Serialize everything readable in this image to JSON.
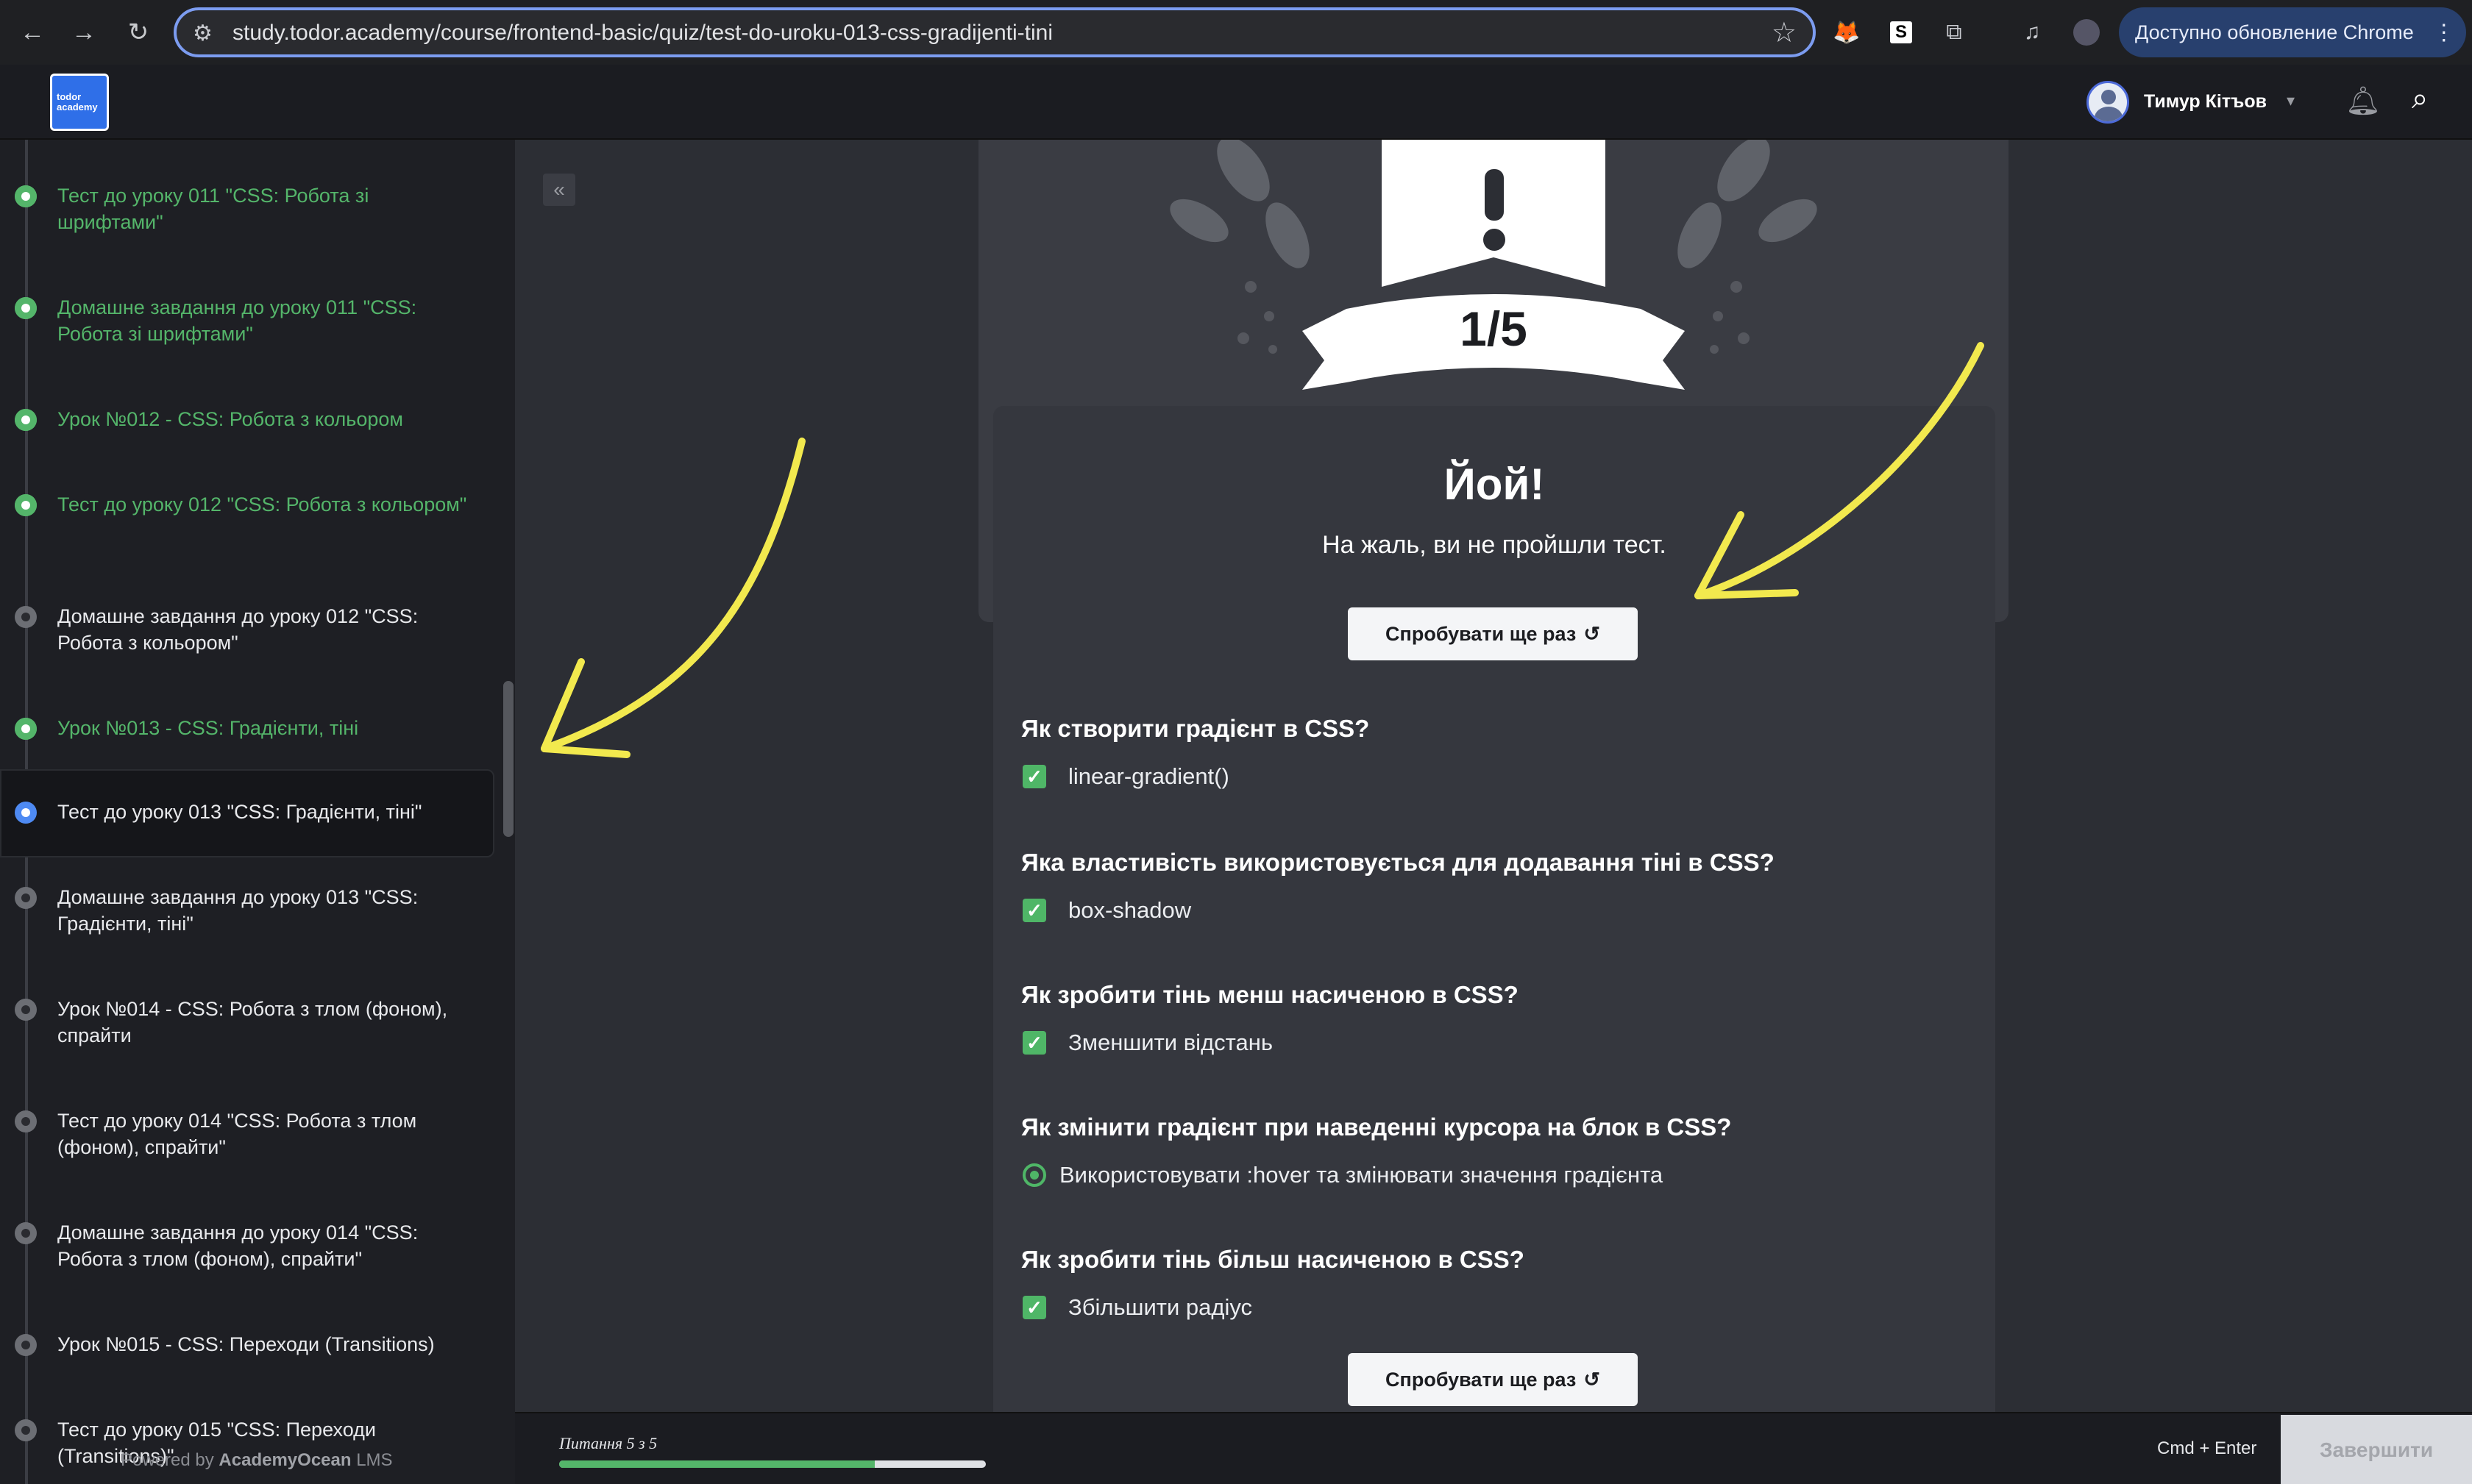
{
  "browser": {
    "url": "study.todor.academy/course/frontend-basic/quiz/test-do-uroku-013-css-gradijenti-tini",
    "update_label": "Доступно обновление Chrome",
    "nav_icons": [
      "back-icon",
      "forward-icon",
      "reload-icon"
    ]
  },
  "header": {
    "logo_text": "todor academy",
    "user_name": "Тимур Кітъов"
  },
  "sidebar": {
    "items": [
      {
        "label": "Тест до уроку 011 \"CSS: Робота зі шрифтами\"",
        "status": "done"
      },
      {
        "label": "Домашне завдання до уроку 011 \"CSS: Робота зі шрифтами\"",
        "status": "done"
      },
      {
        "label": "Урок №012 - CSS: Робота з кольором",
        "status": "done"
      },
      {
        "label": "Тест до уроку 012 \"CSS: Робота з кольором\"",
        "status": "done"
      },
      {
        "label": "Домашне завдання до уроку 012 \"CSS: Робота з кольором\"",
        "status": "todo"
      },
      {
        "label": "Урок №013 - CSS: Градієнти, тіні",
        "status": "done"
      },
      {
        "label": "Тест до уроку 013 \"CSS: Градієнти, тіні\"",
        "status": "current"
      },
      {
        "label": "Домашне завдання до уроку 013 \"CSS: Градієнти, тіні\"",
        "status": "todo"
      },
      {
        "label": "Урок №014 - CSS: Робота з тлом (фоном), спрайти",
        "status": "todo"
      },
      {
        "label": "Тест до уроку 014 \"CSS: Робота з тлом (фоном), спрайти\"",
        "status": "todo"
      },
      {
        "label": "Домашне завдання до уроку 014 \"CSS: Робота з тлом (фоном), спрайти\"",
        "status": "todo"
      },
      {
        "label": "Урок №015 - CSS: Переходи (Transitions)",
        "status": "todo"
      },
      {
        "label": "Тест до уроку 015 \"CSS: Переходи (Transitions)\"",
        "status": "todo"
      }
    ],
    "powered_prefix": "Powered by",
    "powered_brand": "AcademyOcean",
    "powered_suffix": "LMS"
  },
  "result": {
    "score": "1/5",
    "title": "Йой!",
    "subtitle": "На жаль, ви не пройшли тест.",
    "retry_label": "Спробувати ще раз"
  },
  "questions": [
    {
      "question": "Як створити градієнт в CSS?",
      "answer": "linear-gradient()",
      "kind": "checkbox"
    },
    {
      "question": "Яка властивість використовується для додавання тіні в CSS?",
      "answer": "box-shadow",
      "kind": "checkbox"
    },
    {
      "question": "Як зробити тінь менш насиченою в CSS?",
      "answer": "Зменшити відстань",
      "kind": "checkbox"
    },
    {
      "question": "Як змінити градієнт при наведенні курсора на блок в CSS?",
      "answer": "Використовувати :hover та змінювати значення градієнта",
      "kind": "radio"
    },
    {
      "question": "Як зробити тінь більш насиченою в CSS?",
      "answer": "Збільшити радіус",
      "kind": "checkbox"
    }
  ],
  "footer": {
    "progress_label": "Питання 5 з 5",
    "progress_fraction": 0.74,
    "shortcut": "Cmd + Enter",
    "finish_label": "Завершити"
  },
  "colors": {
    "accent_green": "#54b56a",
    "current_blue": "#4e8af3",
    "annotation_yellow": "#f2e94e"
  }
}
